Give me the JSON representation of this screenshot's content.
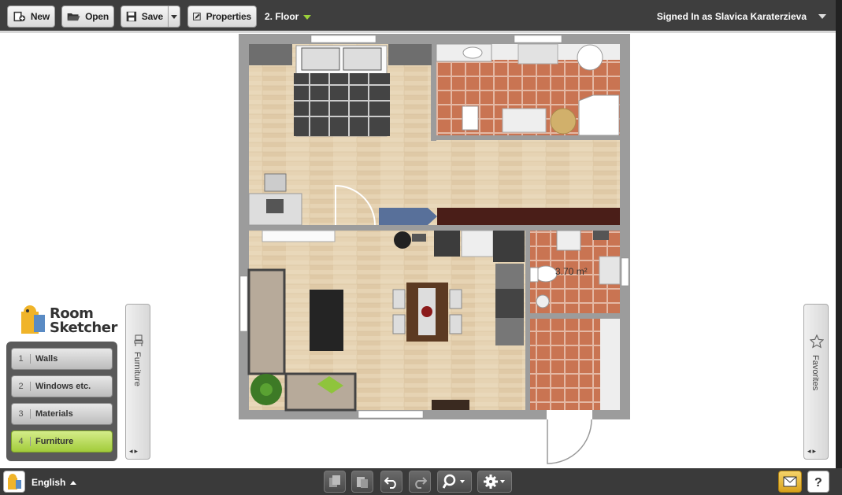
{
  "toolbar": {
    "new_label": "New",
    "open_label": "Open",
    "save_label": "Save",
    "properties_label": "Properties",
    "floor_label": "2. Floor",
    "signed_in_label": "Signed In as Slavica Karaterzieva"
  },
  "plan": {
    "area_label": "3.70 m²"
  },
  "logo": {
    "line1": "Room",
    "line2": "Sketcher"
  },
  "steps": [
    {
      "number": "1",
      "label": "Walls"
    },
    {
      "number": "2",
      "label": "Windows etc."
    },
    {
      "number": "3",
      "label": "Materials"
    },
    {
      "number": "4",
      "label": "Furniture"
    }
  ],
  "panels": {
    "furniture_label": "Furniture",
    "favorites_label": "Favorites"
  },
  "bottombar": {
    "language_label": "English"
  },
  "colors": {
    "accent_green": "#a2cc3a",
    "toolbar_bg": "#3e3e3e"
  }
}
